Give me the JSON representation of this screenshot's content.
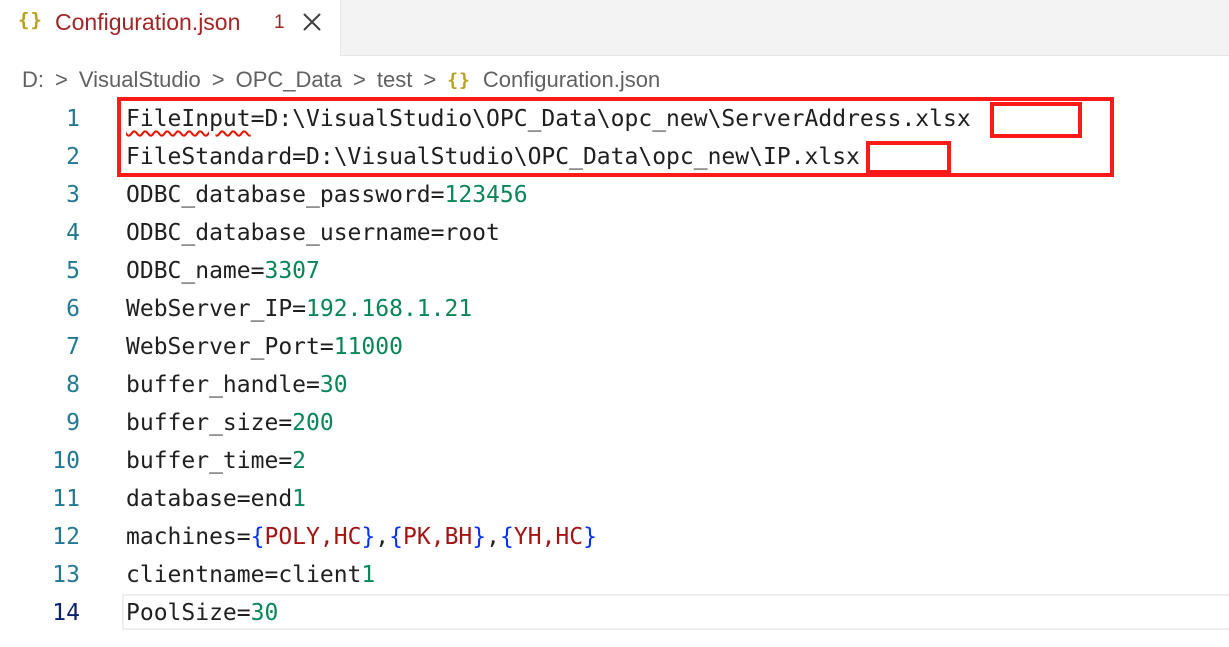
{
  "tab": {
    "icon": "{}",
    "title": "Configuration.json",
    "problems_count": "1",
    "close_icon": "close-icon"
  },
  "breadcrumb": {
    "items": [
      "D:",
      "VisualStudio",
      "OPC_Data",
      "test"
    ],
    "file_icon": "{}",
    "file": "Configuration.json",
    "separator": ">"
  },
  "editor": {
    "active_line": 14,
    "lines": [
      {
        "number": "1",
        "key": "FileInput",
        "value": "=D:\\VisualStudio\\OPC_Data\\opc_new\\ServerAddress.xlsx"
      },
      {
        "number": "2",
        "key": "FileStandard",
        "value": "=D:\\VisualStudio\\OPC_Data\\opc_new\\IP.xlsx"
      },
      {
        "number": "3",
        "key": "ODBC_database_password=",
        "value": "123456"
      },
      {
        "number": "4",
        "key": "ODBC_database_username=root",
        "value": ""
      },
      {
        "number": "5",
        "key": "ODBC_name=",
        "value": "3307"
      },
      {
        "number": "6",
        "key": "WebServer_IP=",
        "value": "192.168.1.21"
      },
      {
        "number": "7",
        "key": "WebServer_Port=",
        "value": "11000"
      },
      {
        "number": "8",
        "key": "buffer_handle=",
        "value": "30"
      },
      {
        "number": "9",
        "key": "buffer_size=",
        "value": "200"
      },
      {
        "number": "10",
        "key": "buffer_time=",
        "value": "2"
      },
      {
        "number": "11",
        "key": "database=end",
        "value": "1"
      },
      {
        "number": "12",
        "key": "machines=",
        "value": ""
      },
      {
        "number": "13",
        "key": "clientname=client",
        "value": "1"
      },
      {
        "number": "14",
        "key": "PoolSize=",
        "value": "30"
      }
    ],
    "machines": [
      {
        "a": "POLY",
        "b": "HC"
      },
      {
        "a": "PK",
        "b": "BH"
      },
      {
        "a": "YH",
        "b": "HC"
      }
    ]
  },
  "colors": {
    "number": "#098658",
    "brace": "#0431fa",
    "identifier": "#a31515",
    "annotation": "#ff1a1a",
    "tab_title": "#a12525"
  }
}
